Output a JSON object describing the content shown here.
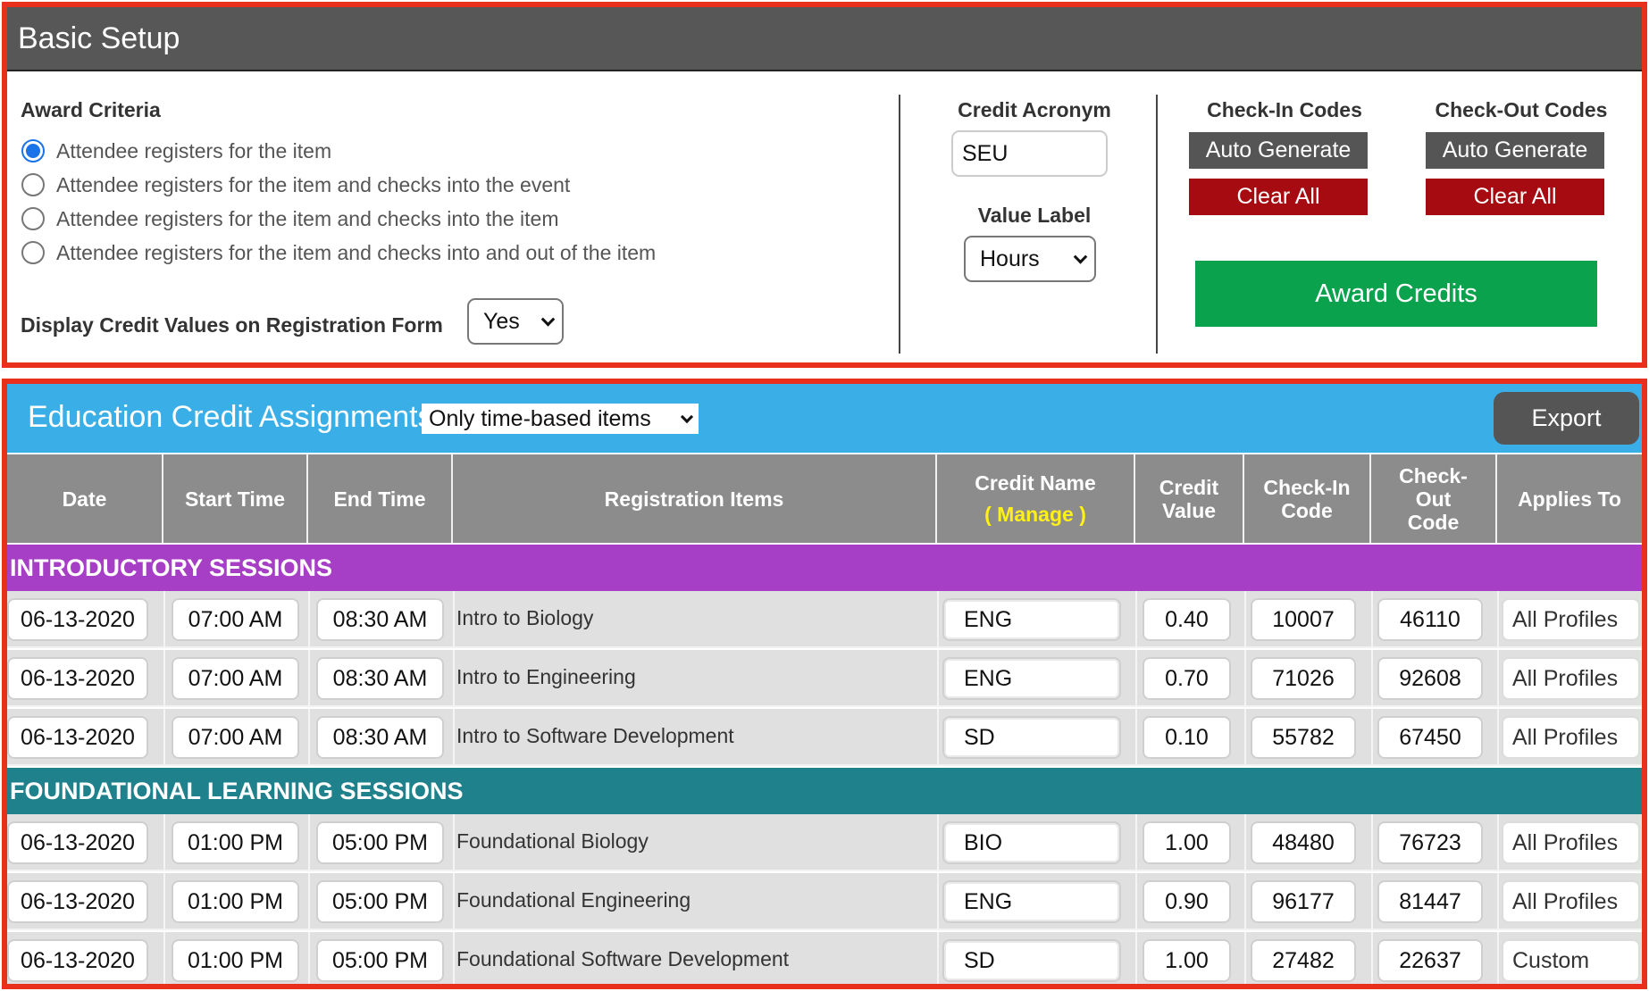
{
  "basic_setup": {
    "title": "Basic Setup",
    "award_criteria_label": "Award Criteria",
    "award_options": [
      {
        "label": "Attendee registers for the item",
        "selected": true
      },
      {
        "label": "Attendee registers for the item and checks into the event",
        "selected": false
      },
      {
        "label": "Attendee registers for the item and checks into the item",
        "selected": false
      },
      {
        "label": "Attendee registers for the item and checks into and out of the item",
        "selected": false
      }
    ],
    "display_credit_label": "Display Credit Values on Registration Form",
    "display_credit_value": "Yes",
    "credit_acronym_label": "Credit Acronym",
    "credit_acronym_value": "SEU",
    "value_label_label": "Value Label",
    "value_label_value": "Hours",
    "checkin_codes_label": "Check-In Codes",
    "checkout_codes_label": "Check-Out Codes",
    "auto_generate_label": "Auto Generate",
    "clear_all_label": "Clear All",
    "award_credits_label": "Award Credits"
  },
  "education": {
    "title": "Education Credit Assignments",
    "filter_value": "Only time-based items",
    "export_label": "Export",
    "columns": {
      "date": "Date",
      "start_time": "Start Time",
      "end_time": "End Time",
      "registration_items": "Registration Items",
      "credit_name": "Credit Name",
      "manage": "( Manage )",
      "credit_value_1": "Credit",
      "credit_value_2": "Value",
      "checkin_1": "Check-In",
      "checkin_2": "Code",
      "checkout_1": "Check-",
      "checkout_2": "Out",
      "checkout_3": "Code",
      "applies_to": "Applies To"
    },
    "groups": [
      {
        "name": "INTRODUCTORY SESSIONS",
        "color": "#a63ec6",
        "rows": [
          {
            "date": "06-13-2020",
            "start": "07:00 AM",
            "end": "08:30 AM",
            "item": "Intro to Biology",
            "credit_name": "ENG",
            "credit_value": "0.40",
            "checkin": "10007",
            "checkout": "46110",
            "applies": "All Profiles"
          },
          {
            "date": "06-13-2020",
            "start": "07:00 AM",
            "end": "08:30 AM",
            "item": "Intro to Engineering",
            "credit_name": "ENG",
            "credit_value": "0.70",
            "checkin": "71026",
            "checkout": "92608",
            "applies": "All Profiles"
          },
          {
            "date": "06-13-2020",
            "start": "07:00 AM",
            "end": "08:30 AM",
            "item": "Intro to Software Development",
            "credit_name": "SD",
            "credit_value": "0.10",
            "checkin": "55782",
            "checkout": "67450",
            "applies": "All Profiles"
          }
        ]
      },
      {
        "name": "FOUNDATIONAL LEARNING SESSIONS",
        "color": "#1f818b",
        "rows": [
          {
            "date": "06-13-2020",
            "start": "01:00 PM",
            "end": "05:00 PM",
            "item": "Foundational Biology",
            "credit_name": "BIO",
            "credit_value": "1.00",
            "checkin": "48480",
            "checkout": "76723",
            "applies": "All Profiles"
          },
          {
            "date": "06-13-2020",
            "start": "01:00 PM",
            "end": "05:00 PM",
            "item": "Foundational Engineering",
            "credit_name": "ENG",
            "credit_value": "0.90",
            "checkin": "96177",
            "checkout": "81447",
            "applies": "All Profiles"
          },
          {
            "date": "06-13-2020",
            "start": "01:00 PM",
            "end": "05:00 PM",
            "item": "Foundational Software Development",
            "credit_name": "SD",
            "credit_value": "1.00",
            "checkin": "27482",
            "checkout": "22637",
            "applies": "Custom"
          }
        ]
      }
    ]
  }
}
